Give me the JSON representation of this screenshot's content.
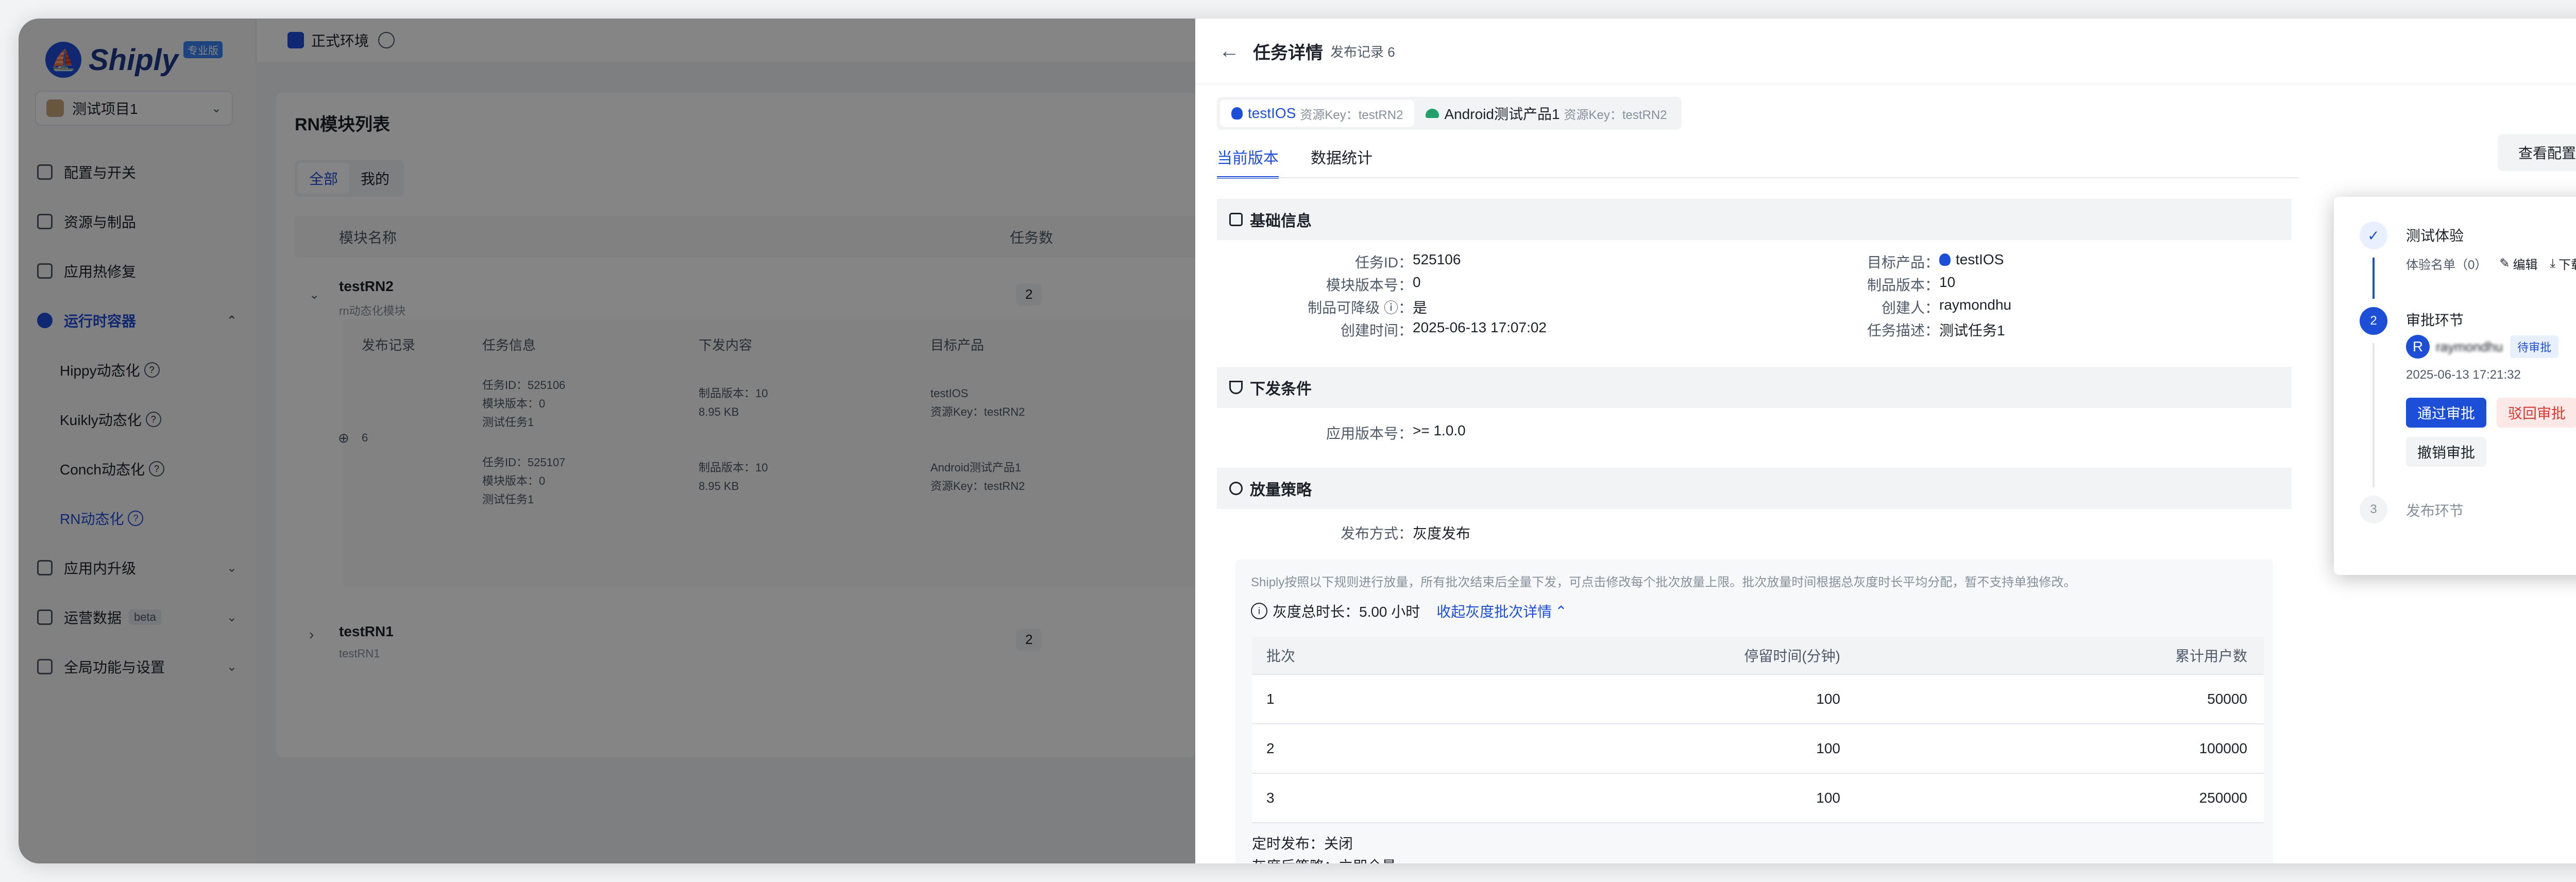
{
  "app": {
    "brand": "Shiply",
    "brand_badge": "专业版",
    "project": "测试项目1",
    "env": "正式环境",
    "nav": [
      {
        "label": "配置与开关"
      },
      {
        "label": "资源与制品"
      },
      {
        "label": "应用热修复"
      },
      {
        "label": "运行时容器"
      },
      {
        "label": "Hippy动态化"
      },
      {
        "label": "Kuikly动态化"
      },
      {
        "label": "Conch动态化"
      },
      {
        "label": "RN动态化"
      },
      {
        "label": "应用内升级"
      },
      {
        "label": "运营数据"
      },
      {
        "label": "全局功能与设置"
      }
    ],
    "beta": "beta",
    "page_title": "RN模块列表",
    "filter_tabs": [
      "全部",
      "我的"
    ],
    "table_headers": [
      "模块名称",
      "任务数"
    ],
    "modules": [
      {
        "name": "testRN2",
        "desc": "rn动态化模块",
        "count": "2"
      },
      {
        "name": "testRN1",
        "desc": "testRN1",
        "count": "2"
      }
    ],
    "sub_headers": [
      "发布记录",
      "任务信息",
      "下发内容",
      "目标产品"
    ],
    "record_no": "6",
    "tasks": [
      {
        "id": "任务ID：525106",
        "ver": "模块版本：0",
        "name": "测试任务1",
        "prod_ver": "制品版本：10",
        "size": "8.95 KB",
        "target": "testIOS",
        "key": "资源Key：testRN2"
      },
      {
        "id": "任务ID：525107",
        "ver": "模块版本：0",
        "name": "测试任务1",
        "prod_ver": "制品版本：10",
        "size": "8.95 KB",
        "target": "Android测试产品1",
        "key": "资源Key：testRN2"
      }
    ]
  },
  "drawer": {
    "title": "任务详情",
    "subtitle": "发布记录 6",
    "product_tabs": [
      {
        "name": "testIOS",
        "key": "资源Key：testRN2"
      },
      {
        "name": "Android测试产品1",
        "key": "资源Key：testRN2"
      }
    ],
    "tabs": [
      "当前版本",
      "数据统计"
    ],
    "config_button": "查看配置信息",
    "basic": {
      "title": "基础信息",
      "left": [
        {
          "k": "任务ID：",
          "v": "525106"
        },
        {
          "k": "模块版本号：",
          "v": "0"
        },
        {
          "k": "制品可降级",
          "v": "是"
        },
        {
          "k": "创建时间：",
          "v": "2025-06-13 17:07:02"
        }
      ],
      "right": [
        {
          "k": "目标产品：",
          "v": "testIOS"
        },
        {
          "k": "制品版本：",
          "v": "10"
        },
        {
          "k": "创建人：",
          "v": "raymondhu"
        },
        {
          "k": "任务描述：",
          "v": "测试任务1"
        }
      ]
    },
    "condition": {
      "title": "下发条件",
      "k": "应用版本号：",
      "v": ">= 1.0.0"
    },
    "strategy": {
      "title": "放量策略",
      "mode_k": "发布方式：",
      "mode_v": "灰度发布",
      "note": "Shiply按照以下规则进行放量，所有批次结束后全量下发，可点击修改每个批次放量上限。批次放量时间根据总灰度时长平均分配，暂不支持单独修改。",
      "duration": "灰度总时长：5.00 小时",
      "collapse_link": "收起灰度批次详情",
      "headers": [
        "批次",
        "停留时间(分钟)",
        "累计用户数"
      ],
      "rows": [
        [
          "1",
          "100",
          "50000"
        ],
        [
          "2",
          "100",
          "100000"
        ],
        [
          "3",
          "100",
          "250000"
        ]
      ],
      "timed_release": "定时发布：关闭",
      "after_gray": "灰度后策略：立即全量"
    }
  },
  "approval": {
    "step1": {
      "title": "测试体验",
      "list": "体验名单（0）",
      "edit": "编辑",
      "download": "下载"
    },
    "step2": {
      "title": "审批环节",
      "num": "2",
      "avatar": "R",
      "user": "raymondhu",
      "status": "待审批",
      "time": "2025-06-13 17:21:32",
      "approve": "通过审批",
      "reject": "驳回审批",
      "revoke": "撤销审批"
    },
    "step3": {
      "title": "发布环节",
      "num": "3"
    }
  }
}
